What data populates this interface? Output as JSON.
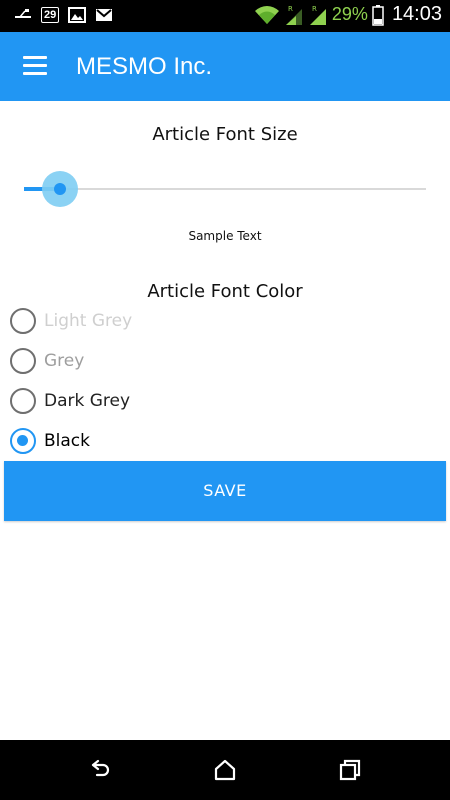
{
  "status_bar": {
    "notification_badge": "29",
    "battery_percent": "29%",
    "time": "14:03",
    "icons": [
      "usb-icon",
      "calendar-icon",
      "image-icon",
      "gmail-icon",
      "wifi-icon",
      "signal-icon",
      "signal-roaming-icon",
      "battery-icon"
    ],
    "signal_color": "#8fd14f"
  },
  "app_bar": {
    "title": "MESMO Inc.",
    "menu_icon": "hamburger-menu-icon",
    "color": "#2196f3"
  },
  "font_size": {
    "title": "Article Font Size",
    "slider_value_fraction": 0.09,
    "sample_text": "Sample Text"
  },
  "font_color": {
    "title": "Article Font Color",
    "options": [
      {
        "label": "Light Grey",
        "color": "#cfcfcf",
        "selected": false
      },
      {
        "label": "Grey",
        "color": "#9e9e9e",
        "selected": false
      },
      {
        "label": "Dark Grey",
        "color": "#222222",
        "selected": false
      },
      {
        "label": "Black",
        "color": "#000000",
        "selected": true
      }
    ]
  },
  "save_button": {
    "label": "SAVE"
  },
  "nav_bar": {
    "icons": [
      "back-icon",
      "home-icon",
      "recents-icon"
    ]
  },
  "colors": {
    "accent": "#2196f3",
    "slider_halo": "#7ecdf3"
  }
}
